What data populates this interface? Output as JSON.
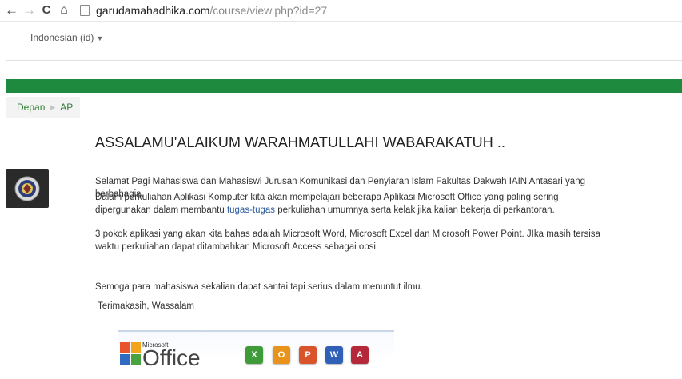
{
  "browser": {
    "back_icon": "←",
    "forward_icon": "→",
    "reload_icon": "C",
    "home_icon": "⌂",
    "url_domain": "garudamahadhika.com",
    "url_path": "/course/view.php?id=27"
  },
  "language": {
    "label": "Indonesian (id)"
  },
  "breadcrumb": {
    "items": [
      "Depan",
      "AP"
    ]
  },
  "content": {
    "heading": "ASSALAMU'ALAIKUM WARAHMATULLAHI WABARAKATUH ..",
    "p1": "Selamat Pagi Mahasiswa dan Mahasiswi Jurusan Komunikasi dan Penyiaran Islam Fakultas Dakwah IAIN Antasari yang berbahagia.",
    "p2_before": "Dalam perkuliahan Aplikasi Komputer kita akan mempelajari beberapa Aplikasi Microsoft Office yang paling sering dipergunakan dalam membantu ",
    "p2_link": "tugas-tugas",
    "p2_after": " perkuliahan umumnya serta kelak jika kalian bekerja di perkantoran.",
    "p3": "3 pokok aplikasi yang akan kita bahas adalah Microsoft Word, Microsoft Excel dan Microsoft Power Point. JIka masih tersisa waktu perkuliahan dapat ditambahkan Microsoft Access sebagai opsi.",
    "p4": "Semoga para mahasiswa sekalian dapat santai tapi serius dalam menuntut ilmu.",
    "p5": "Terimakasih, Wassalam"
  },
  "office_banner": {
    "brand_small": "Microsoft",
    "brand_large": "Office",
    "apps": [
      {
        "name": "excel",
        "letter": "X",
        "color": "#3f9b3a"
      },
      {
        "name": "outlook",
        "letter": "O",
        "color": "#e8941c"
      },
      {
        "name": "powerpoint",
        "letter": "P",
        "color": "#d9532b"
      },
      {
        "name": "word",
        "letter": "W",
        "color": "#2f5fb7"
      },
      {
        "name": "access",
        "letter": "A",
        "color": "#b5283a"
      }
    ]
  },
  "colors": {
    "accent_green": "#1d8a3d",
    "link_blue": "#2b5c9e",
    "breadcrumb_green": "#2e7d32"
  }
}
